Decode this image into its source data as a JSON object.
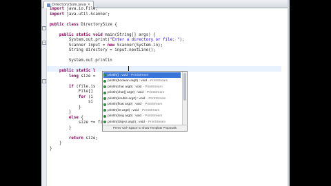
{
  "editor": {
    "tab_title": "DirectorySize.java",
    "close_glyph": "✕"
  },
  "code_lines": [
    {
      "parts": [
        {
          "t": "import",
          "c": "kw"
        },
        {
          "t": " java.io.File;"
        }
      ]
    },
    {
      "parts": [
        {
          "t": "import",
          "c": "kw"
        },
        {
          "t": " java.util.Scanner;"
        }
      ]
    },
    {
      "parts": [
        {
          "t": ""
        }
      ]
    },
    {
      "parts": [
        {
          "t": "public class",
          "c": "kw"
        },
        {
          "t": " DirectorySize {"
        }
      ]
    },
    {
      "parts": [
        {
          "t": ""
        }
      ]
    },
    {
      "parts": [
        {
          "t": "    "
        },
        {
          "t": "public static void",
          "c": "kw"
        },
        {
          "t": " main(String[] args) {"
        }
      ]
    },
    {
      "parts": [
        {
          "t": "        System.out.print("
        },
        {
          "t": "\"Enter a directory or file: \"",
          "c": "str"
        },
        {
          "t": ");"
        }
      ]
    },
    {
      "parts": [
        {
          "t": "        Scanner input = "
        },
        {
          "t": "new",
          "c": "kw"
        },
        {
          "t": " Scanner(System.in);"
        }
      ]
    },
    {
      "parts": [
        {
          "t": "        String directory = input.nextLine();"
        }
      ]
    },
    {
      "parts": [
        {
          "t": ""
        }
      ]
    },
    {
      "parts": [
        {
          "t": "        System.out.println"
        }
      ]
    },
    {
      "parts": [
        {
          "t": ""
        }
      ]
    },
    {
      "parts": [
        {
          "t": "    "
        },
        {
          "t": "public static l",
          "c": "kw"
        }
      ]
    },
    {
      "parts": [
        {
          "t": "        "
        },
        {
          "t": "long",
          "c": "kw"
        },
        {
          "t": " size ="
        }
      ]
    },
    {
      "parts": [
        {
          "t": ""
        }
      ]
    },
    {
      "parts": [
        {
          "t": "        "
        },
        {
          "t": "if",
          "c": "kw"
        },
        {
          "t": " (file.is"
        }
      ]
    },
    {
      "parts": [
        {
          "t": "            File[]"
        }
      ]
    },
    {
      "parts": [
        {
          "t": "            "
        },
        {
          "t": "for",
          "c": "kw"
        },
        {
          "t": " (i"
        }
      ]
    },
    {
      "parts": [
        {
          "t": "                si"
        }
      ]
    },
    {
      "parts": [
        {
          "t": "            }"
        }
      ]
    },
    {
      "parts": [
        {
          "t": "        }"
        }
      ]
    },
    {
      "parts": [
        {
          "t": "        "
        },
        {
          "t": "else",
          "c": "kw"
        },
        {
          "t": " {"
        }
      ]
    },
    {
      "parts": [
        {
          "t": "            size += file.length();"
        }
      ]
    },
    {
      "parts": [
        {
          "t": "        }"
        }
      ]
    },
    {
      "parts": [
        {
          "t": ""
        }
      ]
    },
    {
      "parts": [
        {
          "t": "        "
        },
        {
          "t": "return",
          "c": "kw"
        },
        {
          "t": " size;"
        }
      ]
    },
    {
      "parts": [
        {
          "t": "    }"
        }
      ]
    },
    {
      "parts": [
        {
          "t": "}"
        }
      ]
    }
  ],
  "autocomplete": {
    "items": [
      {
        "name": "println() : void",
        "type": " - PrintStream"
      },
      {
        "name": "println(boolean arg0) : void",
        "type": " - PrintStream"
      },
      {
        "name": "println(char arg0) : void",
        "type": " - PrintStream"
      },
      {
        "name": "println(char[] arg0) : void",
        "type": " - PrintStream"
      },
      {
        "name": "println(double arg0) : void",
        "type": " - PrintStream"
      },
      {
        "name": "println(float arg0) : void",
        "type": " - PrintStream"
      },
      {
        "name": "println(int arg0) : void",
        "type": " - PrintStream"
      },
      {
        "name": "println(long arg0) : void",
        "type": " - PrintStream"
      },
      {
        "name": "println(Object arg0) : void",
        "type": " - PrintStream"
      }
    ],
    "hint": "Press 'Ctrl+Space' to show Template Proposals"
  },
  "colors": {
    "keyword": "#7f0055",
    "string": "#2a00ff",
    "selection": "#3875d7"
  }
}
